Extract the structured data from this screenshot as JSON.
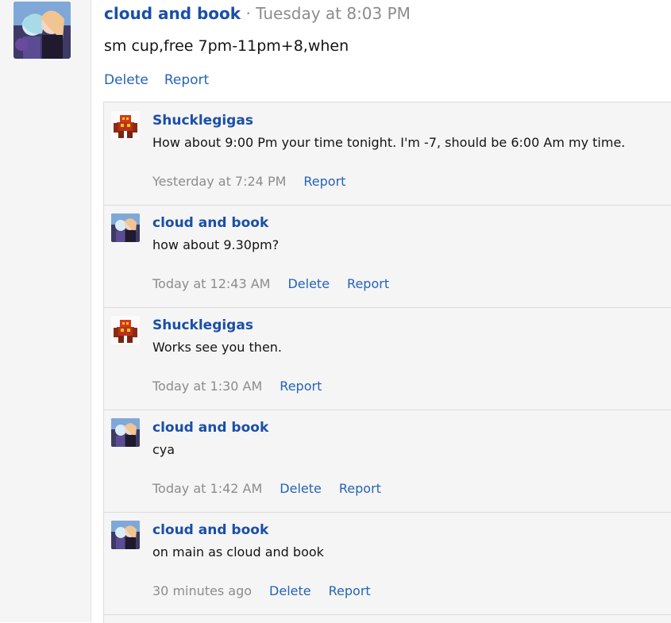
{
  "post": {
    "author": "cloud and book",
    "meta": " · Tuesday at 8:03 PM",
    "body": "sm cup,free 7pm-11pm+8,when",
    "delete_label": "Delete",
    "report_label": "Report"
  },
  "comments": [
    {
      "author": "Shucklegigas",
      "avatar": "robot-avatar",
      "text": "How about 9:00 Pm your time tonight. I'm -7, should be 6:00 Am my time.",
      "time": "Yesterday at 7:24 PM",
      "report": "Report"
    },
    {
      "author": "cloud and book",
      "avatar": "anime-avatar",
      "text": "how about 9.30pm?",
      "time": "Today at 12:43 AM",
      "delete": "Delete",
      "report": "Report"
    },
    {
      "author": "Shucklegigas",
      "avatar": "robot-avatar",
      "text": "Works see you then.",
      "time": "Today at 1:30 AM",
      "report": "Report"
    },
    {
      "author": "cloud and book",
      "avatar": "anime-avatar",
      "text": "cya",
      "time": "Today at 1:42 AM",
      "delete": "Delete",
      "report": "Report"
    },
    {
      "author": "cloud and book",
      "avatar": "anime-avatar",
      "text": "on main as cloud and book",
      "time": "30 minutes ago",
      "delete": "Delete",
      "report": "Report"
    }
  ],
  "colors": {
    "author": "#1a4fa8",
    "link": "#2563b8",
    "muted": "#8c8c8c",
    "panel": "#f5f5f5"
  }
}
